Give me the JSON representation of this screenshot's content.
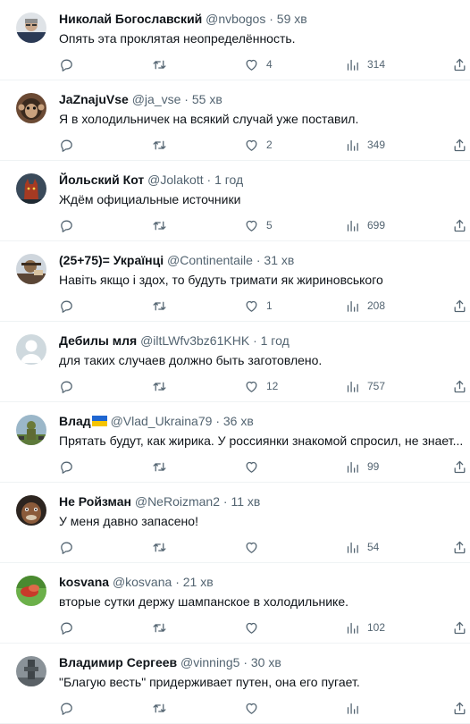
{
  "colors": {
    "text": "#0f1419",
    "muted": "#536471",
    "divider": "#eff3f4"
  },
  "icons": {
    "reply": "comment-icon",
    "retweet": "retweet-icon",
    "like": "heart-icon",
    "views": "analytics-icon",
    "share": "share-icon"
  },
  "tweets": [
    {
      "name": "Николай Богославский",
      "handle": "@nvbogos",
      "sep": "·",
      "time": "59 хв",
      "text": "Опять эта проклятая неопределённость.",
      "replies": "",
      "retweets": "",
      "likes": "4",
      "views": "314"
    },
    {
      "name": "JaZnajuVse",
      "handle": "@ja_vse",
      "sep": "·",
      "time": "55 хв",
      "text": "Я в холодильничек на всякий случай уже поставил.",
      "replies": "",
      "retweets": "",
      "likes": "2",
      "views": "349"
    },
    {
      "name": "Йольский Кот",
      "handle": "@Jolakott",
      "sep": "·",
      "time": "1 год",
      "text": "Ждём официальные источники",
      "replies": "",
      "retweets": "",
      "likes": "5",
      "views": "699"
    },
    {
      "name": "(25+75)= Українці",
      "handle": "@Continentaile",
      "sep": "·",
      "time": "31 хв",
      "text": "Навіть якщо і здох, то будуть тримати як жириновського",
      "replies": "",
      "retweets": "",
      "likes": "1",
      "views": "208"
    },
    {
      "name": "Дебилы мля",
      "handle": "@iltLWfv3bz61KHK",
      "sep": "·",
      "time": "1 год",
      "text": "для таких случаев должно быть заготовлено.",
      "replies": "",
      "retweets": "",
      "likes": "12",
      "views": "757"
    },
    {
      "name": "Влад",
      "handle": "@Vlad_Ukraina79",
      "sep": "·",
      "time": "36 хв",
      "text": "Прятать будут, как жирика. У россиянки знакомой спросил, не знает....",
      "replies": "",
      "retweets": "",
      "likes": "",
      "views": "99"
    },
    {
      "name": "Не Ройзман",
      "handle": "@NeRoizman2",
      "sep": "·",
      "time": "11 хв",
      "text": "У меня давно запасено!",
      "replies": "",
      "retweets": "",
      "likes": "",
      "views": "54"
    },
    {
      "name": "kosvana",
      "handle": "@kosvana",
      "sep": "·",
      "time": "21 хв",
      "text": "вторые сутки держу шампанское в холодильнике.",
      "replies": "",
      "retweets": "",
      "likes": "",
      "views": "102"
    },
    {
      "name": "Владимир Сергеев",
      "handle": "@vinning5",
      "sep": "·",
      "time": "30 хв",
      "text": "\"Благую весть\" придерживает путен, она его пугает.",
      "replies": "",
      "retweets": "",
      "likes": "",
      "views": ""
    }
  ]
}
